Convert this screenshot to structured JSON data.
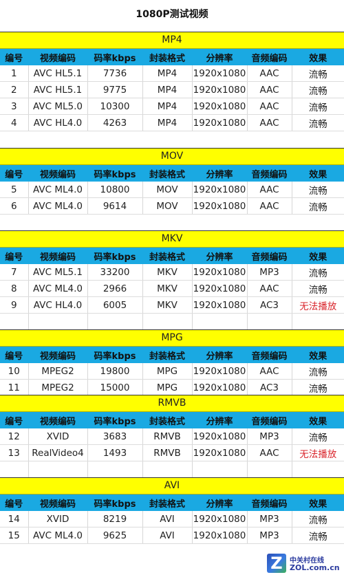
{
  "title": "1080P测试视频",
  "headers": [
    "编号",
    "视频编码",
    "码率kbps",
    "封装格式",
    "分辨率",
    "音频编码",
    "效果"
  ],
  "colors": {
    "section_bg": "#ffff00",
    "header_bg": "#1aa9e2",
    "fail_text": "#d9242b"
  },
  "sections": [
    {
      "format": "MP4",
      "rows": [
        [
          "1",
          "AVC HL5.1",
          "7736",
          "MP4",
          "1920x1080",
          "AAC",
          "流畅"
        ],
        [
          "2",
          "AVC HL5.1",
          "9775",
          "MP4",
          "1920x1080",
          "AAC",
          "流畅"
        ],
        [
          "3",
          "AVC ML5.0",
          "10300",
          "MP4",
          "1920x1080",
          "AAC",
          "流畅"
        ],
        [
          "4",
          "AVC HL4.0",
          "4263",
          "MP4",
          "1920x1080",
          "AAC",
          "流畅"
        ]
      ],
      "empty_rows": 0
    },
    {
      "format": "MOV",
      "rows": [
        [
          "5",
          "AVC ML4.0",
          "10800",
          "MOV",
          "1920x1080",
          "AAC",
          "流畅"
        ],
        [
          "6",
          "AVC ML4.0",
          "9614",
          "MOV",
          "1920x1080",
          "AAC",
          "流畅"
        ]
      ],
      "empty_rows": 0
    },
    {
      "format": "MKV",
      "rows": [
        [
          "7",
          "AVC ML5.1",
          "33200",
          "MKV",
          "1920x1080",
          "MP3",
          "流畅"
        ],
        [
          "8",
          "AVC ML4.0",
          "2966",
          "MKV",
          "1920x1080",
          "AAC",
          "流畅"
        ],
        [
          "9",
          "AVC HL4.0",
          "6005",
          "MKV",
          "1920x1080",
          "AC3",
          "无法播放"
        ]
      ],
      "empty_rows": 1
    },
    {
      "format": "MPG",
      "rows": [
        [
          "10",
          "MPEG2",
          "19800",
          "MPG",
          "1920x1080",
          "AAC",
          "流畅"
        ],
        [
          "11",
          "MPEG2",
          "15000",
          "MPG",
          "1920x1080",
          "AC3",
          "流畅"
        ]
      ],
      "empty_rows": 0
    },
    {
      "format": "RMVB",
      "rows": [
        [
          "12",
          "XVID",
          "3683",
          "RMVB",
          "1920x1080",
          "MP3",
          "流畅"
        ],
        [
          "13",
          "RealVideo4",
          "1493",
          "RMVB",
          "1920x1080",
          "AAC",
          "无法播放"
        ]
      ],
      "empty_rows": 1
    },
    {
      "format": "AVI",
      "rows": [
        [
          "14",
          "XVID",
          "8219",
          "AVI",
          "1920x1080",
          "MP3",
          "流畅"
        ],
        [
          "15",
          "AVC ML4.0",
          "9625",
          "AVI",
          "1920x1080",
          "MP3",
          "流畅"
        ]
      ],
      "empty_rows": 0
    }
  ],
  "fail_label": "无法播放",
  "watermark": {
    "icon": "zol-logo-icon",
    "letter": "Z",
    "cn": "中关村在线",
    "en": "ZOL.com.cn"
  }
}
